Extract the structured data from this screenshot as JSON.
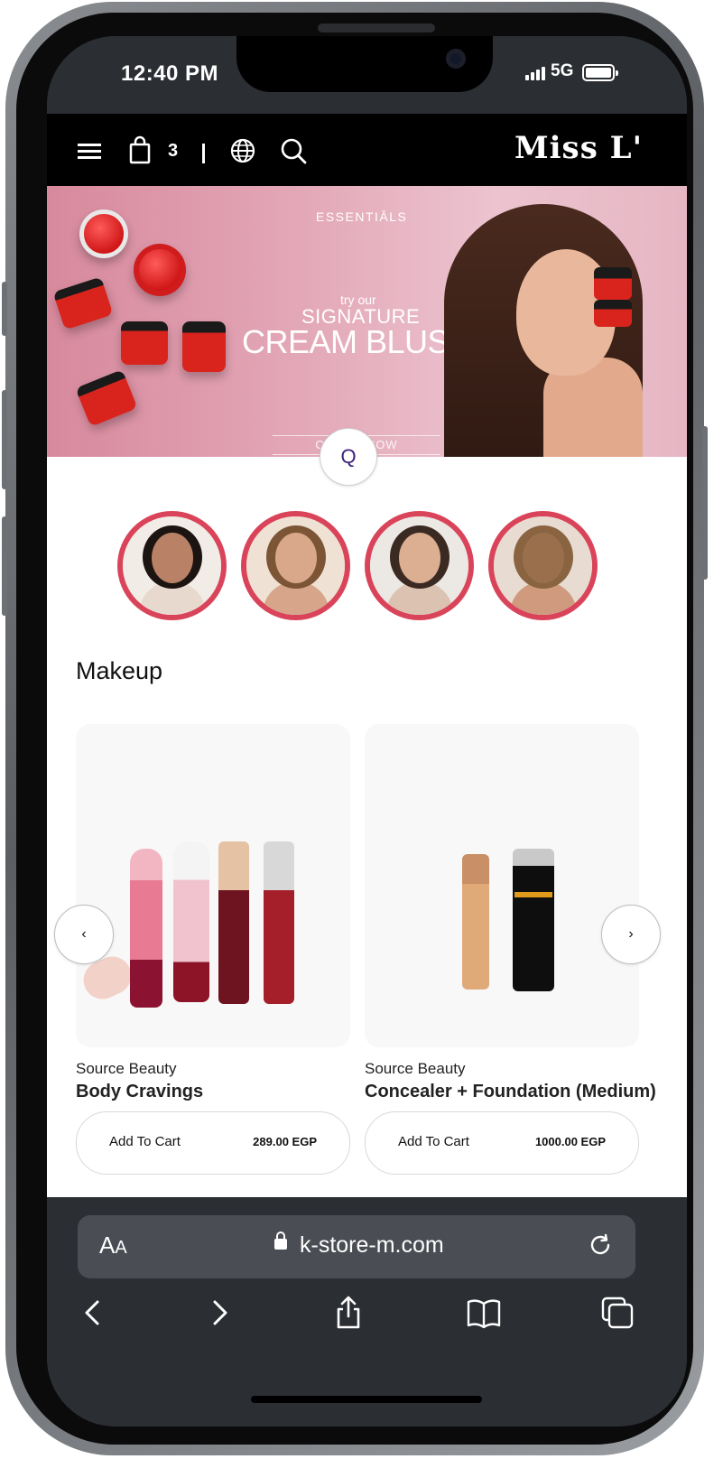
{
  "status_bar": {
    "time": "12:40 PM",
    "network": "5G"
  },
  "header": {
    "cart_count": "3",
    "logo": "Miss L'"
  },
  "banner": {
    "brand": "ESSENTIĀLS",
    "tagline_small": "try our",
    "tagline": "SIGNATURE",
    "title": "CREAM BLUSH",
    "cta": "ORDER NOW"
  },
  "search_fab": {
    "glyph": "Q"
  },
  "stories": [
    {
      "label": "story-1"
    },
    {
      "label": "story-2"
    },
    {
      "label": "story-3"
    },
    {
      "label": "story-4"
    }
  ],
  "section": {
    "title": "Makeup"
  },
  "products": [
    {
      "brand": "Source Beauty",
      "name": "Body Cravings",
      "add_label": "Add To Cart",
      "price": "289.00 EGP"
    },
    {
      "brand": "Source Beauty",
      "name": "Concealer + Foundation (Medium)",
      "add_label": "Add To Cart",
      "price": "1000.00 EGP"
    }
  ],
  "carousel": {
    "prev": "‹",
    "next": "›"
  },
  "browser": {
    "aa_big": "A",
    "aa_small": "A",
    "url": "k-store-m.com"
  },
  "colors": {
    "accent": "#d9445a",
    "header_bg": "#000000",
    "banner_bg": "#e3a8b8",
    "chrome_bg": "#2b2e33"
  }
}
